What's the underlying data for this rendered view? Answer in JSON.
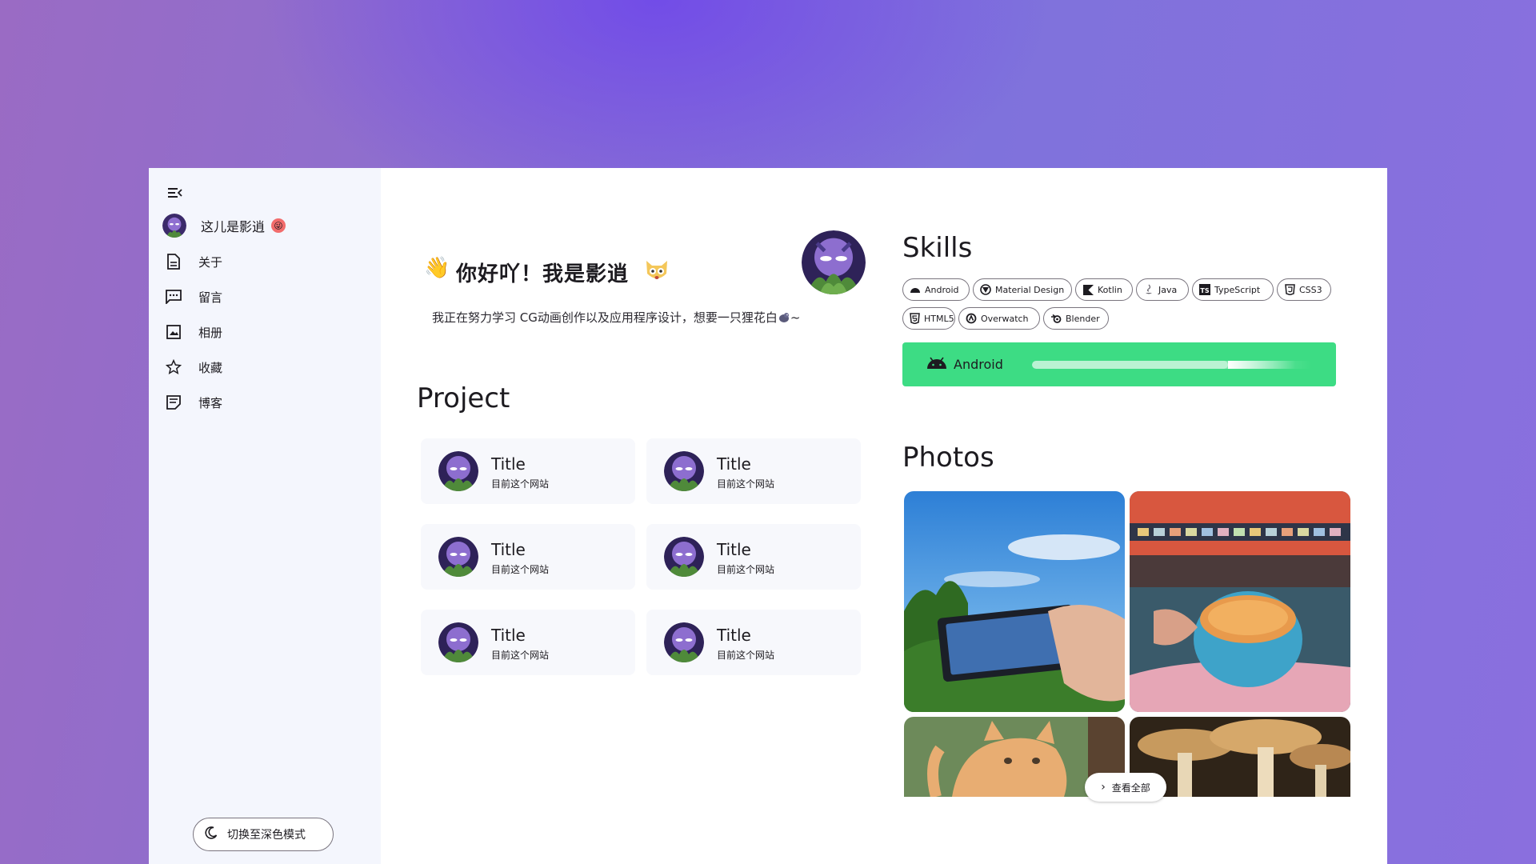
{
  "sidebar": {
    "brand": {
      "label": "这儿是影逍",
      "emoji": "😜"
    },
    "items": [
      {
        "label": "关于",
        "icon": "document-icon"
      },
      {
        "label": "留言",
        "icon": "message-icon"
      },
      {
        "label": "相册",
        "icon": "image-icon"
      },
      {
        "label": "收藏",
        "icon": "star-icon"
      },
      {
        "label": "博客",
        "icon": "notes-icon"
      }
    ],
    "theme_button": "切换至深色模式"
  },
  "hero": {
    "wave": "👋",
    "title": "你好吖！我是影逍",
    "intro": "我正在努力学习 CG动画创作以及应用程序设计，想要一只狸花白",
    "intro_suffix": "~"
  },
  "project": {
    "heading": "Project",
    "cards": [
      {
        "title": "Title",
        "subtitle": "目前这个网站"
      },
      {
        "title": "Title",
        "subtitle": "目前这个网站"
      },
      {
        "title": "Title",
        "subtitle": "目前这个网站"
      },
      {
        "title": "Title",
        "subtitle": "目前这个网站"
      },
      {
        "title": "Title",
        "subtitle": "目前这个网站"
      },
      {
        "title": "Title",
        "subtitle": "目前这个网站"
      }
    ]
  },
  "skills": {
    "heading": "Skills",
    "chips": [
      "Android",
      "Material Design",
      "Kotlin",
      "Java",
      "TypeScript",
      "CSS3",
      "HTML5",
      "Overwatch",
      "Blender"
    ],
    "selected": {
      "label": "Android",
      "level": 0.7
    },
    "accent": "#3ddc84"
  },
  "photos": {
    "heading": "Photos",
    "view_all": "查看全部"
  }
}
